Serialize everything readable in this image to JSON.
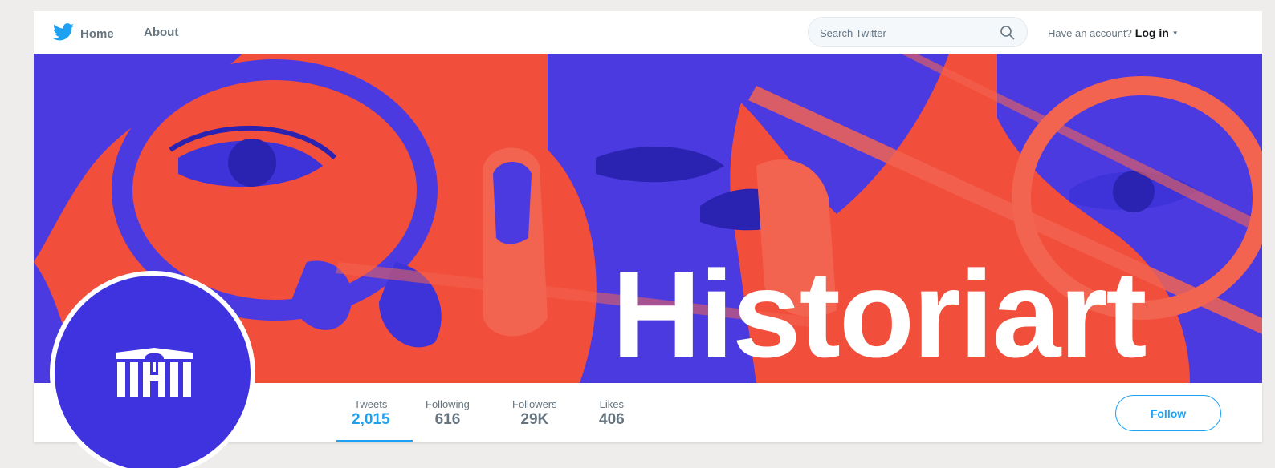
{
  "nav": {
    "home_label": "Home",
    "about_label": "About"
  },
  "search": {
    "placeholder": "Search Twitter"
  },
  "account": {
    "prompt": "Have an account?",
    "login_label": "Log in"
  },
  "banner": {
    "word": "Historiart"
  },
  "stats": [
    {
      "label": "Tweets",
      "value": "2,015"
    },
    {
      "label": "Following",
      "value": "616"
    },
    {
      "label": "Followers",
      "value": "29K"
    },
    {
      "label": "Likes",
      "value": "406"
    }
  ],
  "follow_label": "Follow",
  "colors": {
    "twitter_blue": "#1da1f2",
    "brand_purple": "#3f33e0",
    "banner_red": "#f24e3c"
  },
  "icons": [
    "twitter-bird-icon",
    "search-icon",
    "caret-down-icon",
    "museum-logo-icon"
  ]
}
